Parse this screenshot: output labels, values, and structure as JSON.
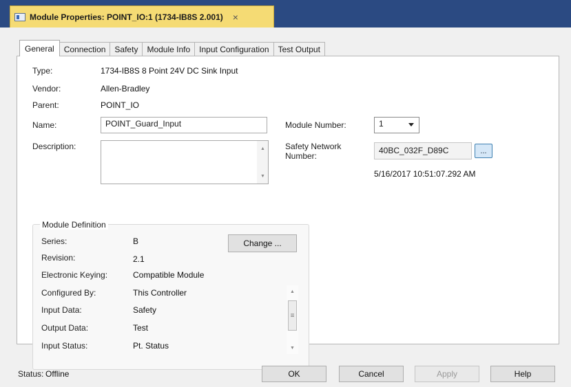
{
  "window": {
    "title": "Module Properties: POINT_IO:1 (1734-IB8S 2.001)",
    "close_symbol": "×"
  },
  "tabs": [
    "General",
    "Connection",
    "Safety",
    "Module Info",
    "Input Configuration",
    "Test Output"
  ],
  "general": {
    "type_label": "Type:",
    "type_value": "1734-IB8S 8 Point 24V DC Sink Input",
    "vendor_label": "Vendor:",
    "vendor_value": "Allen-Bradley",
    "parent_label": "Parent:",
    "parent_value": "POINT_IO",
    "name_label": "Name:",
    "name_value": "POINT_Guard_Input",
    "description_label": "Description:",
    "description_value": "",
    "module_number_label": "Module Number:",
    "module_number_value": "1",
    "safety_network_label_line1": "Safety Network",
    "safety_network_label_line2": "Number:",
    "safety_network_value": "40BC_032F_D89C",
    "browse_label": "...",
    "timestamp": "5/16/2017 10:51:07.292 AM"
  },
  "module_definition": {
    "legend": "Module Definition",
    "change_label": "Change ...",
    "rows": [
      {
        "label": "Series:",
        "value": "B"
      },
      {
        "label": "Revision:",
        "value": "2.1"
      },
      {
        "label": "Electronic Keying:",
        "value": "Compatible Module"
      },
      {
        "label": "Configured By:",
        "value": "This Controller"
      },
      {
        "label": "Input Data:",
        "value": "Safety"
      },
      {
        "label": "Output Data:",
        "value": "Test"
      },
      {
        "label": "Input Status:",
        "value": "Pt. Status"
      }
    ]
  },
  "footer": {
    "status_label": "Status:",
    "status_value": "Offline",
    "ok_label": "OK",
    "cancel_label": "Cancel",
    "apply_label": "Apply",
    "help_label": "Help"
  },
  "icons": {
    "up_arrow": "▲",
    "down_arrow": "▼",
    "grip": "≡"
  }
}
